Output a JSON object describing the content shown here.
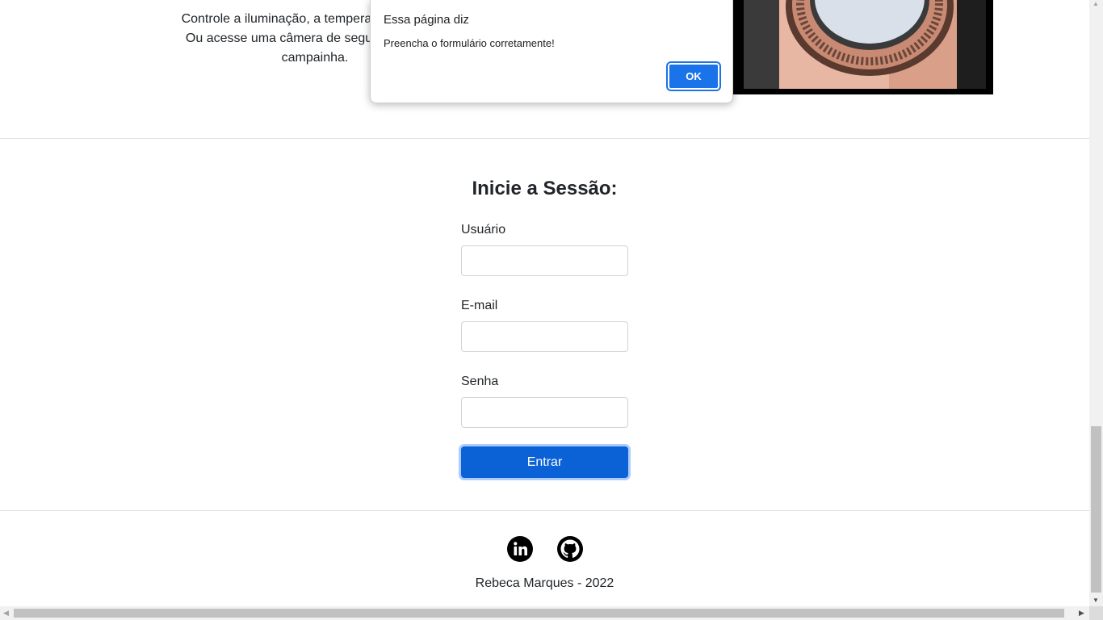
{
  "intro": {
    "line1": "Controle a iluminação, a temperatura, o portão",
    "line2": "Ou acesse uma câmera de segurança para v",
    "line3": "campainha."
  },
  "login": {
    "title": "Inicie a Sessão:",
    "fields": [
      {
        "label": "Usuário",
        "value": "",
        "placeholder": ""
      },
      {
        "label": "E-mail",
        "value": "",
        "placeholder": ""
      },
      {
        "label": "Senha",
        "value": "",
        "placeholder": ""
      }
    ],
    "submit_label": "Entrar"
  },
  "footer": {
    "social_icons": [
      "linkedin-icon",
      "github-icon"
    ],
    "credit": "Rebeca Marques - 2022"
  },
  "dialog": {
    "title": "Essa página diz",
    "message": "Preencha o formulário corretamente!",
    "ok_label": "OK"
  },
  "colors": {
    "primary_button": "#0a62d6",
    "dialog_button": "#1a73e8",
    "divider": "#dee2e6",
    "text": "#212529"
  }
}
